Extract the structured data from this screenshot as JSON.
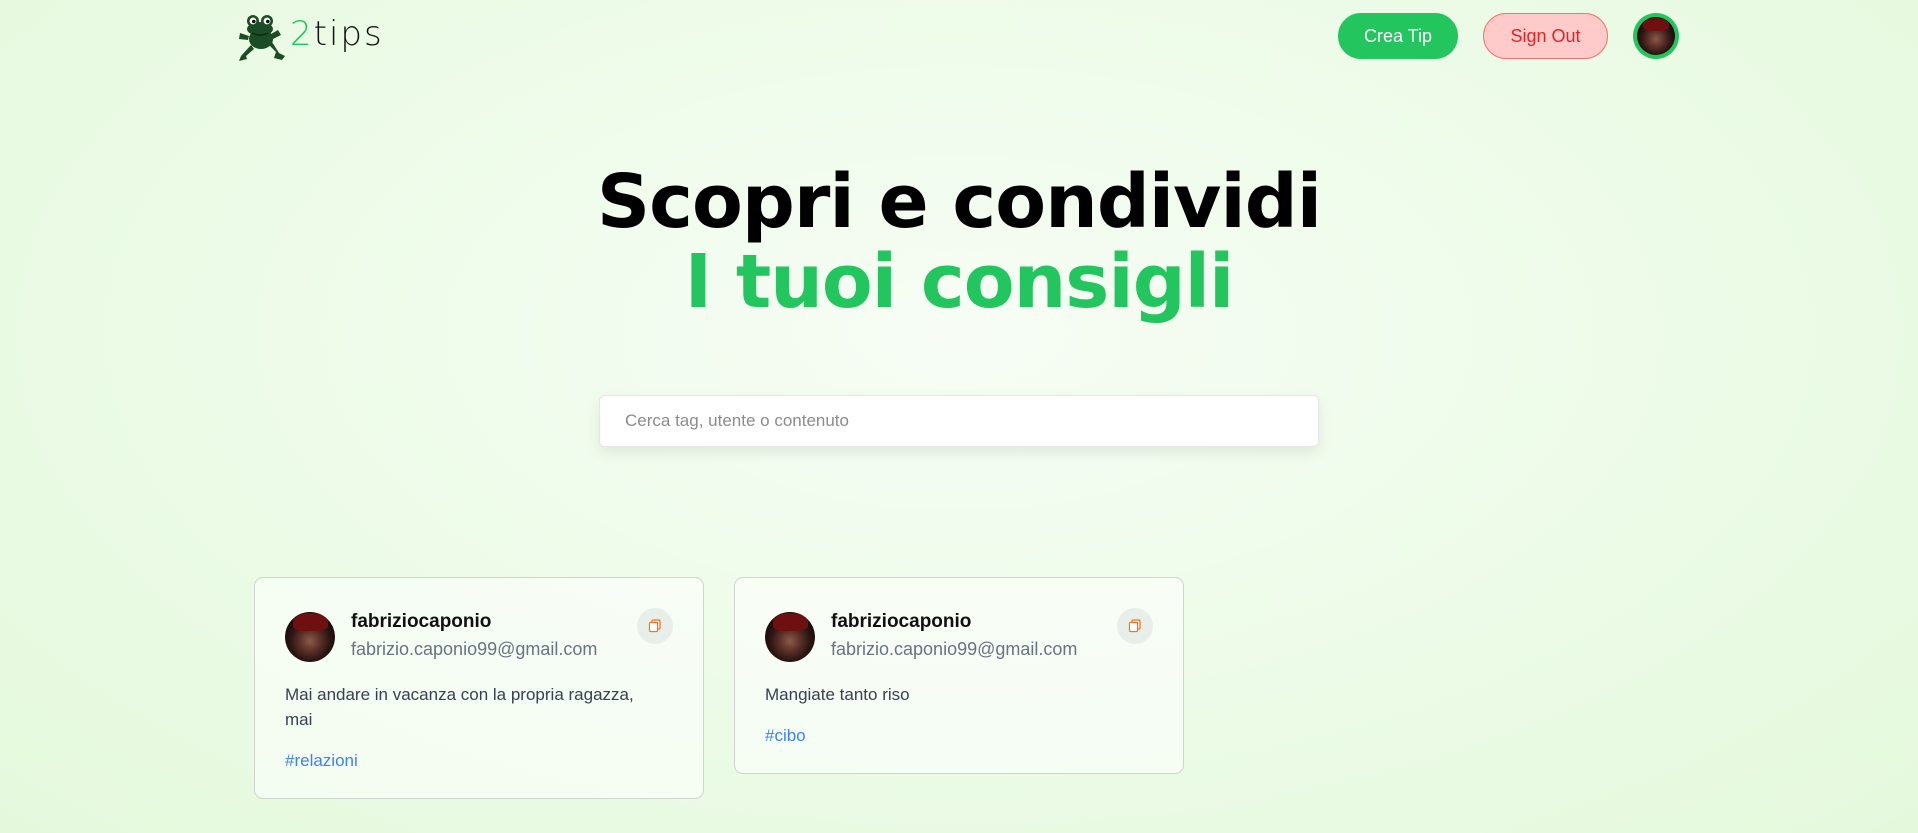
{
  "nav": {
    "logo_two": "2",
    "logo_rest": "tips",
    "create_label": "Crea Tip",
    "signout_label": "Sign Out",
    "logo_icon": "frog-logo-icon",
    "avatar_icon": "user-avatar"
  },
  "hero": {
    "line1": "Scopri e condividi",
    "line2": "I tuoi consigli"
  },
  "search": {
    "placeholder": "Cerca tag, utente o contenuto",
    "value": ""
  },
  "tips": [
    {
      "username": "fabriziocaponio",
      "email": "fabrizio.caponio99@gmail.com",
      "text": "Mai andare in vacanza con la propria ragazza, mai",
      "tag": "#relazioni"
    },
    {
      "username": "fabriziocaponio",
      "email": "fabrizio.caponio99@gmail.com",
      "text": "Mangiate tanto riso",
      "tag": "#cibo"
    }
  ],
  "colors": {
    "accent": "#22c55e",
    "danger": "#dc2626",
    "danger_bg": "#fecaca",
    "tag": "#3b82f6",
    "copy_icon": "#f97316"
  }
}
